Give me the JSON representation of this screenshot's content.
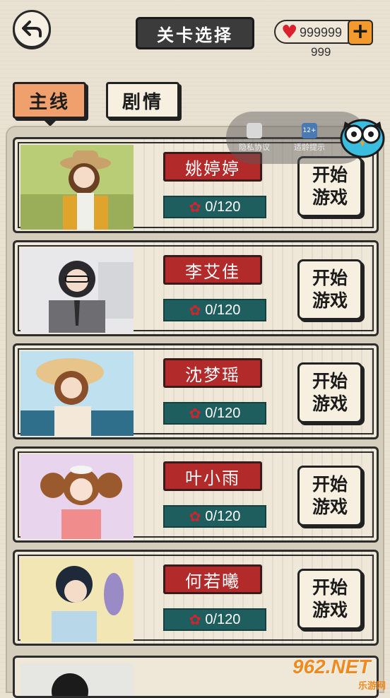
{
  "header": {
    "title": "关卡选择",
    "hearts": "999999",
    "sub_count": "999"
  },
  "tabs": [
    {
      "label": "主线",
      "active": true
    },
    {
      "label": "剧情",
      "active": false
    }
  ],
  "overlay": {
    "privacy": "隐私协议",
    "age": "适龄提示",
    "age_badge": "12+"
  },
  "cards": [
    {
      "name": "姚婷婷",
      "progress": "0/120",
      "button": [
        "开始",
        "游戏"
      ]
    },
    {
      "name": "李艾佳",
      "progress": "0/120",
      "button": [
        "开始",
        "游戏"
      ]
    },
    {
      "name": "沈梦瑶",
      "progress": "0/120",
      "button": [
        "开始",
        "游戏"
      ]
    },
    {
      "name": "叶小雨",
      "progress": "0/120",
      "button": [
        "开始",
        "游戏"
      ]
    },
    {
      "name": "何若曦",
      "progress": "0/120",
      "button": [
        "开始",
        "游戏"
      ]
    }
  ],
  "watermark": {
    "big": "962.NET",
    "small": "乐游网"
  },
  "colors": {
    "accent": "#f0a06c",
    "name_red": "#b32a2a",
    "teal": "#1f5e5e",
    "heart": "#d9222d"
  }
}
